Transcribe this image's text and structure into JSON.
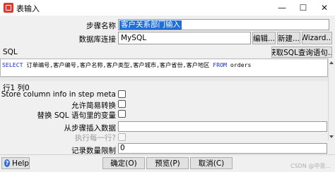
{
  "window": {
    "title": "表输入",
    "minimize": "—",
    "maximize": "☐",
    "close": "✕"
  },
  "form": {
    "step_name_label": "步骤名称",
    "step_name_value": "客户关系部门输入",
    "connection_label": "数据库连接",
    "connection_value": "MySQL",
    "edit_button": "编辑...",
    "new_button": "新建...",
    "wizard_button": "Wizard..."
  },
  "sql": {
    "label": "SQL",
    "get_sql_button": "获取SQL查询语句...",
    "keyword_select": "SELECT",
    "columns": " 订单编号,客户编号,客户名称,客户类型,客户城市,客户省份,客户地区 ",
    "keyword_from": "FROM",
    "table": " orders",
    "cursor_status": "行1 列0"
  },
  "options": {
    "store_column_info_label": "Store column info in step meta",
    "lazy_conversion_label": "允许简易转换",
    "replace_variables_label": "替换 SQL 语句里的变量",
    "insert_data_from_step_label": "从步骤插入数据",
    "execute_each_row_label": "执行每一行?",
    "limit_label": "记录数量限制",
    "limit_value": "0"
  },
  "footer": {
    "help_label": "Help",
    "ok_button": "确定(O)",
    "preview_button": "预览(P)",
    "cancel_button": "取消(C)",
    "watermark": "CSDN @中意..."
  }
}
